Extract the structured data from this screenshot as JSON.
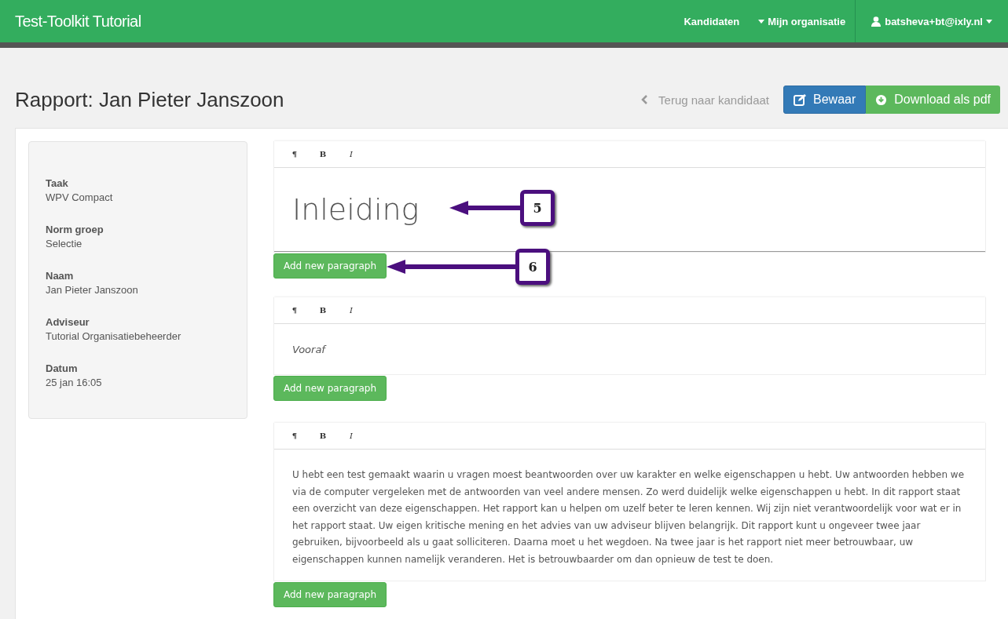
{
  "navbar": {
    "brand": "Test-Toolkit Tutorial",
    "links": [
      {
        "label": "Kandidaten",
        "kind": "plain"
      },
      {
        "label": "Mijn organisatie",
        "kind": "dropdown"
      }
    ],
    "user": "batsheva+bt@ixly.nl"
  },
  "header": {
    "title": "Rapport: Jan Pieter Janszoon",
    "back_link": "Terug naar kandidaat",
    "save_button": "Bewaar",
    "download_button": "Download als pdf"
  },
  "details": [
    {
      "label": "Taak",
      "value": "WPV Compact"
    },
    {
      "label": "Norm groep",
      "value": "Selectie"
    },
    {
      "label": "Naam",
      "value": "Jan Pieter Janszoon"
    },
    {
      "label": "Adviseur",
      "value": "Tutorial Organisatiebeheerder"
    },
    {
      "label": "Datum",
      "value": "25 jan 16:05"
    }
  ],
  "editors": [
    {
      "kind": "heading",
      "toolbar": [
        "¶",
        "B",
        "I"
      ],
      "content": "Inleiding",
      "add_button": "Add new paragraph",
      "callout": "5",
      "button_callout": "6"
    },
    {
      "kind": "italic",
      "toolbar": [
        "¶",
        "B",
        "I"
      ],
      "content": "Vooraf",
      "add_button": "Add new paragraph"
    },
    {
      "kind": "text",
      "toolbar": [
        "¶",
        "B",
        "I"
      ],
      "content": "U hebt een test gemaakt waarin u vragen moest beantwoorden over uw karakter en welke eigenschappen u hebt. Uw antwoorden hebben we via de computer vergeleken met de antwoorden van veel andere mensen. Zo werd duidelijk welke eigenschappen u hebt. In dit rapport staat een overzicht van deze eigenschappen. Het rapport kan u helpen om uzelf beter te leren kennen. Wij zijn niet verantwoordelijk voor wat er in het rapport staat. Uw eigen kritische mening en het advies van uw adviseur blijven belangrijk. Dit rapport kunt u ongeveer twee jaar gebruiken, bijvoorbeeld als u gaat solliciteren. Daarna moet u het wegdoen. Na twee jaar is het rapport niet meer betrouwbaar, uw eigenschappen kunnen namelijk veranderen. Het is betrouwbaarder om dan opnieuw de test te doen.",
      "add_button": "Add new paragraph"
    }
  ]
}
